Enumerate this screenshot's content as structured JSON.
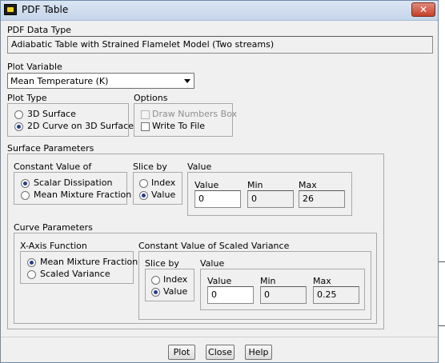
{
  "window": {
    "title": "PDF Table",
    "close_glyph": "✕"
  },
  "pdf_data_type": {
    "label": "PDF Data Type",
    "value": "Adiabatic Table with Strained Flamelet Model (Two streams)"
  },
  "plot_variable": {
    "label": "Plot Variable",
    "selected": "Mean Temperature (K)"
  },
  "plot_type": {
    "label": "Plot Type",
    "options": [
      {
        "label": "3D Surface",
        "selected": false
      },
      {
        "label": "2D Curve on 3D Surface",
        "selected": true
      }
    ]
  },
  "options": {
    "label": "Options",
    "items": [
      {
        "label": "Draw Numbers Box",
        "checked": false,
        "disabled": true
      },
      {
        "label": "Write To File",
        "checked": false,
        "disabled": false
      }
    ]
  },
  "surface_parameters": {
    "label": "Surface Parameters",
    "constant_value_of": {
      "label": "Constant Value of",
      "options": [
        {
          "label": "Scalar Dissipation",
          "selected": true
        },
        {
          "label": "Mean Mixture Fraction",
          "selected": false
        }
      ]
    },
    "slice_by": {
      "label": "Slice by",
      "options": [
        {
          "label": "Index",
          "selected": false
        },
        {
          "label": "Value",
          "selected": true
        }
      ]
    },
    "value_group": {
      "label": "Value",
      "value_label": "Value",
      "min_label": "Min",
      "max_label": "Max",
      "value": "0",
      "min": "0",
      "max": "26"
    }
  },
  "curve_parameters": {
    "label": "Curve Parameters",
    "x_axis_function": {
      "label": "X-Axis Function",
      "options": [
        {
          "label": "Mean Mixture Fraction",
          "selected": true
        },
        {
          "label": "Scaled Variance",
          "selected": false
        }
      ]
    },
    "constant_value_scaled_variance": {
      "label": "Constant Value of Scaled Variance",
      "slice_by": {
        "label": "Slice by",
        "options": [
          {
            "label": "Index",
            "selected": false
          },
          {
            "label": "Value",
            "selected": true
          }
        ]
      },
      "value_group": {
        "label": "Value",
        "value_label": "Value",
        "min_label": "Min",
        "max_label": "Max",
        "value": "0",
        "min": "0",
        "max": "0.25"
      }
    }
  },
  "buttons": {
    "plot": "Plot",
    "close": "Close",
    "help": "Help"
  }
}
